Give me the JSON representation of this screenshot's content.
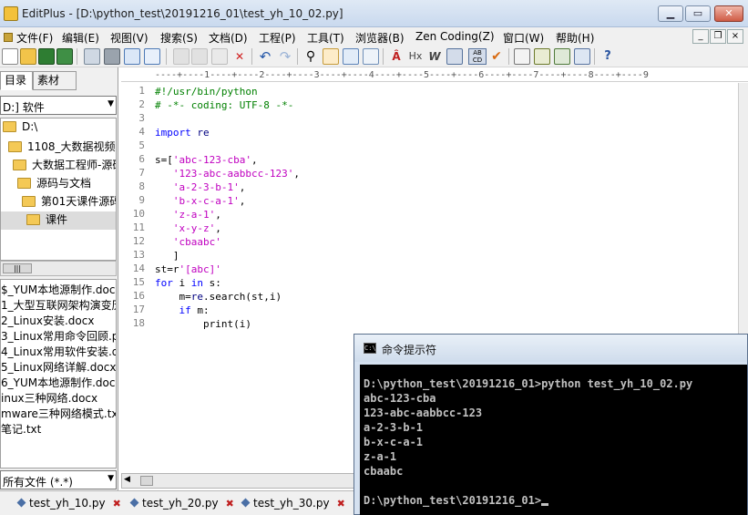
{
  "window": {
    "title": "EditPlus - [D:\\python_test\\20191216_01\\test_yh_10_02.py]",
    "buttons": {
      "minimize": "▁",
      "maximize": "▭",
      "close": "✕"
    }
  },
  "menu": [
    "文件(F)",
    "编辑(E)",
    "视图(V)",
    "搜索(S)",
    "文档(D)",
    "工程(P)",
    "工具(T)",
    "浏览器(B)",
    "Zen Coding(Z)",
    "窗口(W)",
    "帮助(H)"
  ],
  "mdi_controls": {
    "minimize": "_",
    "restore": "❐",
    "close": "×"
  },
  "toolbar": {
    "text_glyphs": {
      "font": "Â",
      "hex": "Hx",
      "word": "W",
      "abc_cd": "AB CD"
    }
  },
  "left_pane": {
    "tabs": {
      "directory": "目录",
      "clipboard": "素材"
    },
    "drive": "D:] 软件",
    "tree": [
      {
        "label": "D:\\",
        "depth": 0
      },
      {
        "label": "1108_大数据视频",
        "depth": 1
      },
      {
        "label": "大数据工程师-源码",
        "depth": 2
      },
      {
        "label": "源码与文档",
        "depth": 3
      },
      {
        "label": "第01天课件源码",
        "depth": 4
      },
      {
        "label": "课件",
        "depth": 5
      }
    ],
    "hscroll_thumb": "|||",
    "files": [
      "$_YUM本地源制作.doc",
      "1_大型互联网架构演变历",
      "2_Linux安装.docx",
      "3_Linux常用命令回顾.p",
      "4_Linux常用软件安装.do",
      "5_Linux网络详解.docx",
      "6_YUM本地源制作.docx",
      "inux三种网络.docx",
      "mware三种网络模式.txt",
      "笔记.txt"
    ],
    "filter": "所有文件 (*.*)"
  },
  "editor": {
    "ruler": "----+----1----+----2----+----3----+----4----+----5----+----6----+----7----+----8----+----9",
    "lines": [
      [
        {
          "t": "#!/usr/bin/python",
          "c": "cmt"
        }
      ],
      [
        {
          "t": "# -*- coding: UTF-8 -*-",
          "c": "cmt"
        }
      ],
      [],
      [
        {
          "t": "import",
          "c": "kw"
        },
        {
          "t": " re",
          "c": "def"
        }
      ],
      [],
      [
        {
          "t": "s=[",
          "c": ""
        },
        {
          "t": "'abc-123-cba'",
          "c": "str"
        },
        {
          "t": ",",
          "c": ""
        }
      ],
      [
        {
          "t": "   ",
          "c": ""
        },
        {
          "t": "'123-abc-aabbcc-123'",
          "c": "str"
        },
        {
          "t": ",",
          "c": ""
        }
      ],
      [
        {
          "t": "   ",
          "c": ""
        },
        {
          "t": "'a-2-3-b-1'",
          "c": "str"
        },
        {
          "t": ",",
          "c": ""
        }
      ],
      [
        {
          "t": "   ",
          "c": ""
        },
        {
          "t": "'b-x-c-a-1'",
          "c": "str"
        },
        {
          "t": ",",
          "c": ""
        }
      ],
      [
        {
          "t": "   ",
          "c": ""
        },
        {
          "t": "'z-a-1'",
          "c": "str"
        },
        {
          "t": ",",
          "c": ""
        }
      ],
      [
        {
          "t": "   ",
          "c": ""
        },
        {
          "t": "'x-y-z'",
          "c": "str"
        },
        {
          "t": ",",
          "c": ""
        }
      ],
      [
        {
          "t": "   ",
          "c": ""
        },
        {
          "t": "'cbaabc'",
          "c": "str"
        }
      ],
      [
        {
          "t": "   ]",
          "c": ""
        }
      ],
      [
        {
          "t": "st=r",
          "c": ""
        },
        {
          "t": "'[abc]'",
          "c": "str"
        }
      ],
      [
        {
          "t": "for",
          "c": "kw"
        },
        {
          "t": " i ",
          "c": ""
        },
        {
          "t": "in",
          "c": "kw"
        },
        {
          "t": " s:",
          "c": ""
        }
      ],
      [
        {
          "t": "    m=",
          "c": ""
        },
        {
          "t": "re",
          "c": "def"
        },
        {
          "t": ".search(st,i)",
          "c": ""
        }
      ],
      [
        {
          "t": "    ",
          "c": ""
        },
        {
          "t": "if",
          "c": "kw"
        },
        {
          "t": " m:",
          "c": ""
        }
      ],
      [
        {
          "t": "        print(i)",
          "c": ""
        }
      ]
    ]
  },
  "doc_tabs": [
    {
      "label": "test_yh_10.py",
      "close": "✖"
    },
    {
      "label": "test_yh_20.py",
      "close": "✖"
    },
    {
      "label": "test_yh_30.py",
      "close": "✖"
    }
  ],
  "cmd_window": {
    "title": "命令提示符",
    "icon": "C:\\",
    "lines": [
      "",
      "D:\\python_test\\20191216_01>python test_yh_10_02.py",
      "abc-123-cba",
      "123-abc-aabbcc-123",
      "a-2-3-b-1",
      "b-x-c-a-1",
      "z-a-1",
      "cbaabc",
      "",
      "D:\\python_test\\20191216_01>"
    ]
  },
  "colors": {
    "comment": "#008000",
    "keyword": "#0000ff",
    "string": "#c000c0",
    "console_bg": "#000000",
    "console_fg": "#c0c0c0"
  }
}
